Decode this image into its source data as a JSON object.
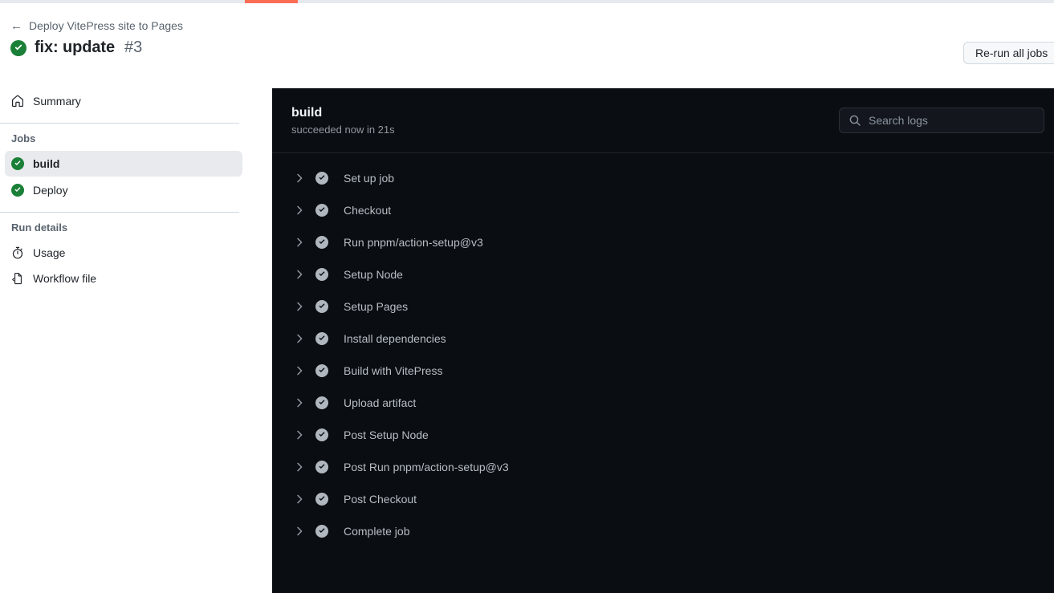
{
  "top_progress": {
    "color": "#fb6e54",
    "track_color": "#e6eaef"
  },
  "header": {
    "back_arrow": "←",
    "breadcrumb": "Deploy VitePress site to Pages",
    "status_icon": "check-circle-fill-icon",
    "title": "fix: update",
    "run_number": "#3",
    "rerun_all_jobs_label": "Re-run all jobs"
  },
  "sidebar": {
    "summary": {
      "icon": "home-icon",
      "label": "Summary"
    },
    "jobs_heading": "Jobs",
    "jobs": [
      {
        "label": "build",
        "status_icon": "check-circle-fill-icon",
        "selected": true
      },
      {
        "label": "Deploy",
        "status_icon": "check-circle-fill-icon",
        "selected": false
      }
    ],
    "run_details_heading": "Run details",
    "run_details": [
      {
        "icon": "stopwatch-icon",
        "label": "Usage"
      },
      {
        "icon": "workflow-file-icon",
        "label": "Workflow file"
      }
    ]
  },
  "log_panel": {
    "job_name": "build",
    "job_status": "succeeded now in 21s",
    "search": {
      "icon": "search-icon",
      "placeholder": "Search logs",
      "value": ""
    },
    "steps": [
      {
        "label": "Set up job",
        "status_icon": "check-circle-fill-icon",
        "chevron": "chevron-right-icon",
        "expanded": false
      },
      {
        "label": "Checkout",
        "status_icon": "check-circle-fill-icon",
        "chevron": "chevron-right-icon",
        "expanded": false
      },
      {
        "label": "Run pnpm/action-setup@v3",
        "status_icon": "check-circle-fill-icon",
        "chevron": "chevron-right-icon",
        "expanded": false
      },
      {
        "label": "Setup Node",
        "status_icon": "check-circle-fill-icon",
        "chevron": "chevron-right-icon",
        "expanded": false
      },
      {
        "label": "Setup Pages",
        "status_icon": "check-circle-fill-icon",
        "chevron": "chevron-right-icon",
        "expanded": false
      },
      {
        "label": "Install dependencies",
        "status_icon": "check-circle-fill-icon",
        "chevron": "chevron-right-icon",
        "expanded": false
      },
      {
        "label": "Build with VitePress",
        "status_icon": "check-circle-fill-icon",
        "chevron": "chevron-right-icon",
        "expanded": false
      },
      {
        "label": "Upload artifact",
        "status_icon": "check-circle-fill-icon",
        "chevron": "chevron-right-icon",
        "expanded": false
      },
      {
        "label": "Post Setup Node",
        "status_icon": "check-circle-fill-icon",
        "chevron": "chevron-right-icon",
        "expanded": false
      },
      {
        "label": "Post Run pnpm/action-setup@v3",
        "status_icon": "check-circle-fill-icon",
        "chevron": "chevron-right-icon",
        "expanded": false
      },
      {
        "label": "Post Checkout",
        "status_icon": "check-circle-fill-icon",
        "chevron": "chevron-right-icon",
        "expanded": false
      },
      {
        "label": "Complete job",
        "status_icon": "check-circle-fill-icon",
        "chevron": "chevron-right-icon",
        "expanded": false
      }
    ]
  },
  "colors": {
    "success_green": "#1a7f37",
    "panel_background": "#0a0d11",
    "accent_orange": "#fb6e54",
    "selected_row": "#e8eaed"
  }
}
